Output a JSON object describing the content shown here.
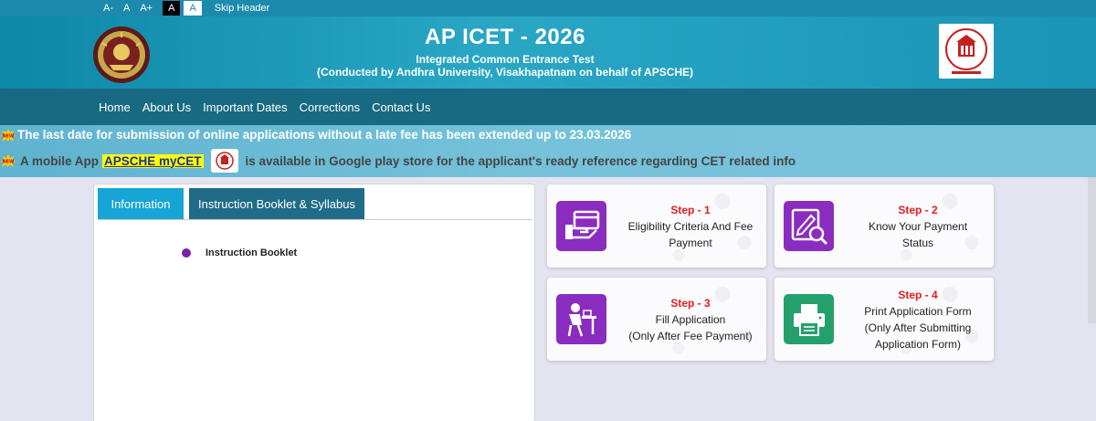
{
  "accessibility": {
    "decrease": "A-",
    "normal": "A",
    "increase": "A+",
    "dark_theme": "A",
    "light_theme": "A",
    "skip": "Skip Header"
  },
  "header": {
    "title": "AP ICET - 2026",
    "subtitle": "Integrated Common Entrance Test",
    "conducted_by": "(Conducted by Andhra University, Visakhapatnam on behalf of APSCHE)"
  },
  "nav": {
    "items": [
      {
        "label": "Home"
      },
      {
        "label": "About Us"
      },
      {
        "label": "Important Dates"
      },
      {
        "label": "Corrections"
      },
      {
        "label": "Contact Us"
      }
    ]
  },
  "announcements": {
    "line1": "The last date for submission of online applications without a late fee has been extended up to 23.03.2026",
    "line2_prefix": "A mobile App",
    "line2_link": "APSCHE myCET",
    "line2_suffix": "is available in Google play store for the applicant's ready reference regarding CET related info",
    "badge": "NEW"
  },
  "tabs": [
    {
      "label": "Information"
    },
    {
      "label": "Instruction Booklet & Syllabus"
    }
  ],
  "info_list": [
    {
      "label": "Instruction Booklet"
    }
  ],
  "steps": [
    {
      "step": "Step - 1",
      "desc1": "Eligibility Criteria And Fee",
      "desc2": "Payment",
      "desc3": ""
    },
    {
      "step": "Step - 2",
      "desc1": "Know Your Payment",
      "desc2": "Status",
      "desc3": ""
    },
    {
      "step": "Step - 3",
      "desc1": "Fill Application",
      "desc2": "(Only After Fee Payment)",
      "desc3": ""
    },
    {
      "step": "Step - 4",
      "desc1": "Print Application Form",
      "desc2": "(Only After Submitting",
      "desc3": "Application Form)"
    }
  ],
  "colors": {
    "header_bg": "#1c8aad",
    "nav_bg": "#186a82",
    "step_title": "#e31d1d",
    "icon_purple": "#8a2cbf",
    "icon_green": "#24a06c",
    "tab_active": "#17a5d6",
    "tab_inactive": "#206c88"
  },
  "icons": {
    "step1": "payment-card-icon",
    "step2": "search-document-icon",
    "step3": "student-desk-icon",
    "step4": "printer-icon"
  }
}
